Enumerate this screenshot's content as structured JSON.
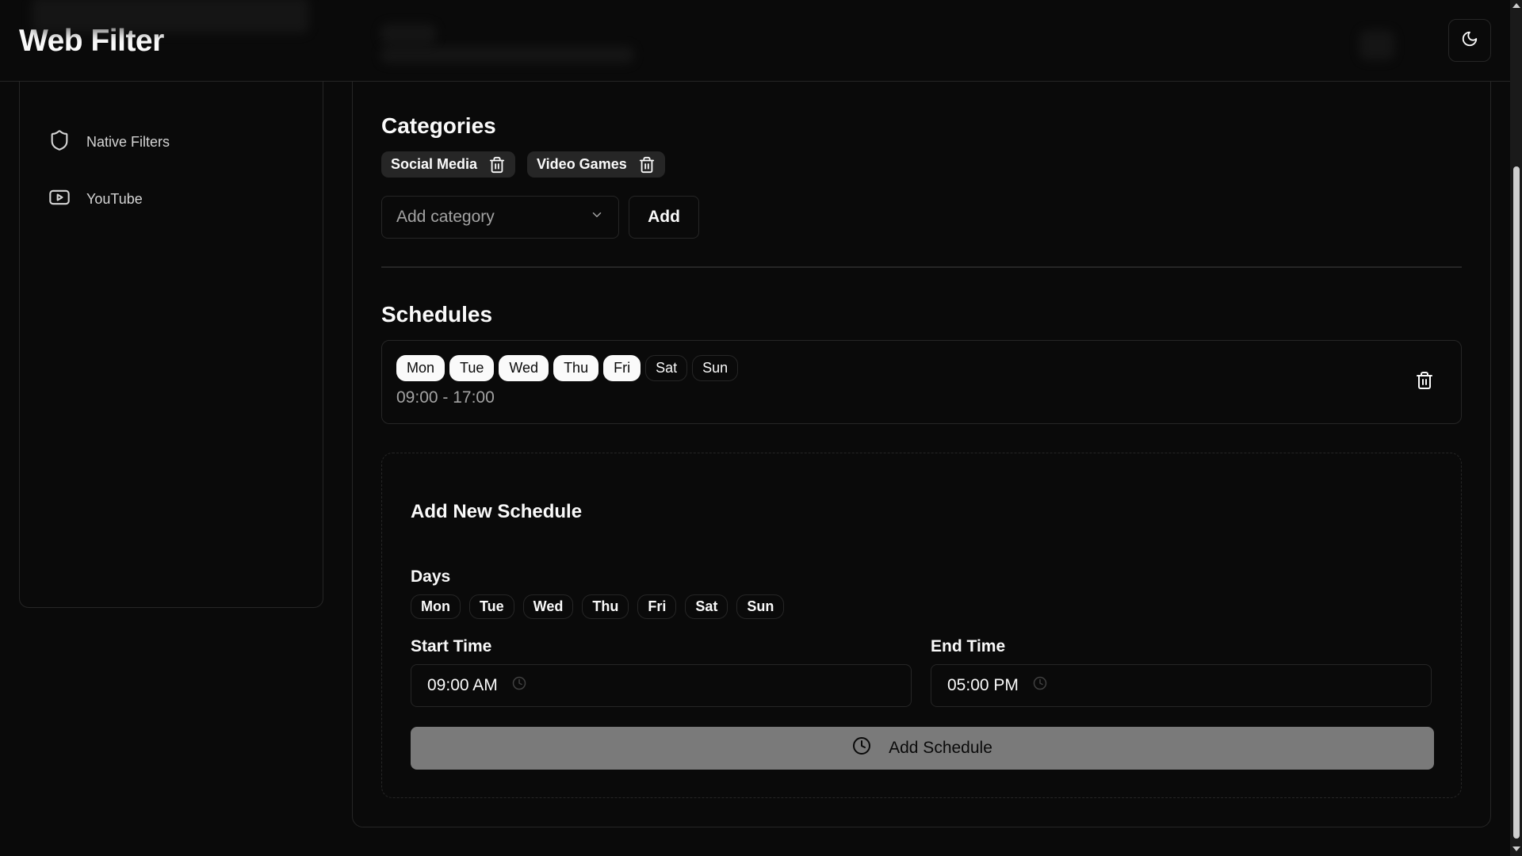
{
  "app": {
    "title": "Web Filter"
  },
  "header": {
    "theme_toggle_icon": "moon-icon"
  },
  "sidebar": {
    "items": [
      {
        "label": "Native Filters",
        "icon": "shield-icon"
      },
      {
        "label": "YouTube",
        "icon": "youtube-icon"
      }
    ]
  },
  "categories": {
    "heading": "Categories",
    "chips": [
      {
        "label": "Social Media"
      },
      {
        "label": "Video Games"
      }
    ],
    "select_placeholder": "Add category",
    "add_label": "Add"
  },
  "schedules": {
    "heading": "Schedules",
    "items": [
      {
        "days": [
          {
            "label": "Mon",
            "active": true
          },
          {
            "label": "Tue",
            "active": true
          },
          {
            "label": "Wed",
            "active": true
          },
          {
            "label": "Thu",
            "active": true
          },
          {
            "label": "Fri",
            "active": true
          },
          {
            "label": "Sat",
            "active": false
          },
          {
            "label": "Sun",
            "active": false
          }
        ],
        "time_range": "09:00 - 17:00"
      }
    ]
  },
  "new_schedule": {
    "heading": "Add New Schedule",
    "days_label": "Days",
    "days": [
      "Mon",
      "Tue",
      "Wed",
      "Thu",
      "Fri",
      "Sat",
      "Sun"
    ],
    "start_label": "Start Time",
    "start_value": "09:00 AM",
    "end_label": "End Time",
    "end_value": "05:00 PM",
    "submit_label": "Add Schedule"
  },
  "colors": {
    "background": "#0a0a0a",
    "border": "#262626",
    "foreground": "#fafafa",
    "muted": "#a3a3a3",
    "disabled_button": "#7a7a7a"
  }
}
